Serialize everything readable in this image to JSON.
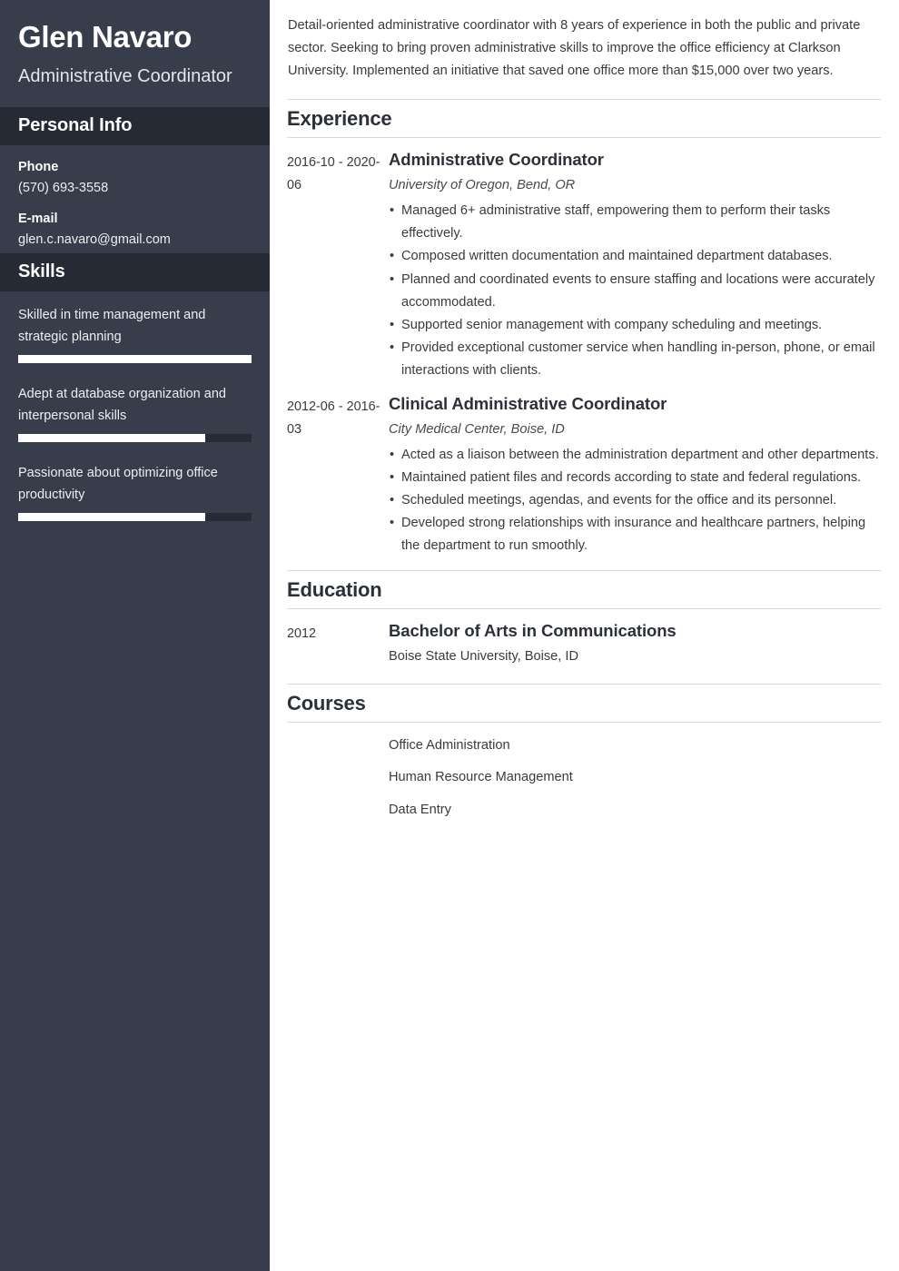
{
  "colors": {
    "sidebar_bg": "#373d4a",
    "sidebar_header_bg": "#252a34",
    "skill_track": "#262b35",
    "skill_fill": "#ffffff",
    "main_text": "#3b3b3b",
    "heading": "#2c3038",
    "rule": "#d8d8d8"
  },
  "sidebar": {
    "full_name": "Glen Navaro",
    "job_title": "Administrative Coordinator",
    "personal_info": {
      "heading": "Personal Info",
      "fields": [
        {
          "label": "Phone",
          "value": "(570) 693-3558"
        },
        {
          "label": "E-mail",
          "value": "glen.c.navaro@gmail.com"
        }
      ]
    },
    "skills": {
      "heading": "Skills",
      "items": [
        {
          "name": "Skilled in time management and strategic planning",
          "level": 100
        },
        {
          "name": "Adept at database organization and interpersonal skills",
          "level": 80
        },
        {
          "name": "Passionate about optimizing office productivity",
          "level": 80
        }
      ]
    }
  },
  "main": {
    "summary": "Detail-oriented administrative coordinator with 8 years of experience in both the public and private sector. Seeking to bring proven administrative skills to improve the office efficiency at Clarkson University. Implemented an initiative that saved one office more than $15,000 over two years.",
    "experience": {
      "heading": "Experience",
      "entries": [
        {
          "dates": "2016-10 - 2020-06",
          "title": "Administrative Coordinator",
          "subtitle": "University of Oregon, Bend, OR",
          "bullets": [
            "Managed 6+ administrative staff, empowering them to perform their tasks effectively.",
            "Composed written documentation and maintained department databases.",
            "Planned and coordinated events to ensure staffing and locations were accurately accommodated.",
            "Supported senior management with company scheduling and meetings.",
            "Provided exceptional customer service when handling in-person, phone, or email interactions with clients."
          ]
        },
        {
          "dates": "2012-06 - 2016-03",
          "title": "Clinical Administrative Coordinator",
          "subtitle": "City Medical Center, Boise, ID",
          "bullets": [
            "Acted as a liaison between the administration department and other departments.",
            "Maintained patient files and records according to state and federal regulations.",
            "Scheduled meetings, agendas, and events for the office and its personnel.",
            "Developed strong relationships with insurance and healthcare partners, helping the department to run smoothly."
          ]
        }
      ]
    },
    "education": {
      "heading": "Education",
      "entries": [
        {
          "dates": "2012",
          "title": "Bachelor of Arts in Communications",
          "subtitle": "Boise State University, Boise, ID"
        }
      ]
    },
    "courses": {
      "heading": "Courses",
      "items": [
        "Office Administration",
        "Human Resource Management",
        "Data Entry"
      ]
    }
  }
}
